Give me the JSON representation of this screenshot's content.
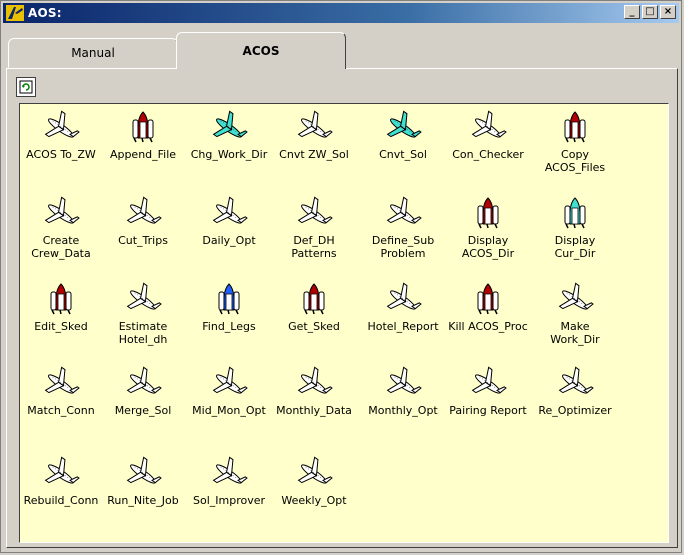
{
  "window": {
    "title": "AOS:",
    "minimize": "_",
    "maximize": "□",
    "close": "×"
  },
  "tabs": [
    {
      "label": "Manual",
      "active": false
    },
    {
      "label": "ACOS",
      "active": true
    }
  ],
  "toolbar": {
    "refresh_icon": "refresh-icon"
  },
  "colors": {
    "plane_white": "#ffffff",
    "plane_cyan": "#40e0d0",
    "shuttle_red": "#b00000",
    "shuttle_cyan": "#40e0d0",
    "shuttle_blue": "#2060ff",
    "panel_bg": "#ffffcc"
  },
  "items": [
    {
      "label": "ACOS To_ZW",
      "icon": "plane",
      "variant": "white"
    },
    {
      "label": "Append_File",
      "icon": "shuttle",
      "variant": "red"
    },
    {
      "label": "Chg_Work_Dir",
      "icon": "plane",
      "variant": "cyan"
    },
    {
      "label": "Cnvt ZW_Sol",
      "icon": "plane",
      "variant": "white"
    },
    {
      "label": "Cnvt_Sol",
      "icon": "plane",
      "variant": "cyan"
    },
    {
      "label": "Con_Checker",
      "icon": "plane",
      "variant": "white"
    },
    {
      "label": "Copy\nACOS_Files",
      "icon": "shuttle",
      "variant": "red"
    },
    {
      "label": "Create\nCrew_Data",
      "icon": "plane",
      "variant": "white"
    },
    {
      "label": "Cut_Trips",
      "icon": "plane",
      "variant": "white"
    },
    {
      "label": "Daily_Opt",
      "icon": "plane",
      "variant": "white"
    },
    {
      "label": "Def_DH\nPatterns",
      "icon": "plane",
      "variant": "white"
    },
    {
      "label": "Define_Sub\nProblem",
      "icon": "plane",
      "variant": "white"
    },
    {
      "label": "Display\nACOS_Dir",
      "icon": "shuttle",
      "variant": "red"
    },
    {
      "label": "Display\nCur_Dir",
      "icon": "shuttle",
      "variant": "cyan"
    },
    {
      "label": "Edit_Sked",
      "icon": "shuttle",
      "variant": "red"
    },
    {
      "label": "Estimate\nHotel_dh",
      "icon": "plane",
      "variant": "white"
    },
    {
      "label": "Find_Legs",
      "icon": "shuttle",
      "variant": "blue"
    },
    {
      "label": "Get_Sked",
      "icon": "shuttle",
      "variant": "red"
    },
    {
      "label": "Hotel_Report",
      "icon": "plane",
      "variant": "white"
    },
    {
      "label": "Kill ACOS_Proc",
      "icon": "shuttle",
      "variant": "red"
    },
    {
      "label": "Make\nWork_Dir",
      "icon": "plane",
      "variant": "white"
    },
    {
      "label": "Match_Conn",
      "icon": "plane",
      "variant": "white"
    },
    {
      "label": "Merge_Sol",
      "icon": "plane",
      "variant": "white"
    },
    {
      "label": "Mid_Mon_Opt",
      "icon": "plane",
      "variant": "white"
    },
    {
      "label": "Monthly_Data",
      "icon": "plane",
      "variant": "white"
    },
    {
      "label": "Monthly_Opt",
      "icon": "plane",
      "variant": "white"
    },
    {
      "label": "Pairing Report",
      "icon": "plane",
      "variant": "white"
    },
    {
      "label": "Re_Optimizer",
      "icon": "plane",
      "variant": "white"
    },
    {
      "label": "Rebuild_Conn",
      "icon": "plane",
      "variant": "white"
    },
    {
      "label": "Run_Nite_Job",
      "icon": "plane",
      "variant": "white"
    },
    {
      "label": "Sol_Improver",
      "icon": "plane",
      "variant": "white"
    },
    {
      "label": "Weekly_Opt",
      "icon": "plane",
      "variant": "white"
    }
  ]
}
